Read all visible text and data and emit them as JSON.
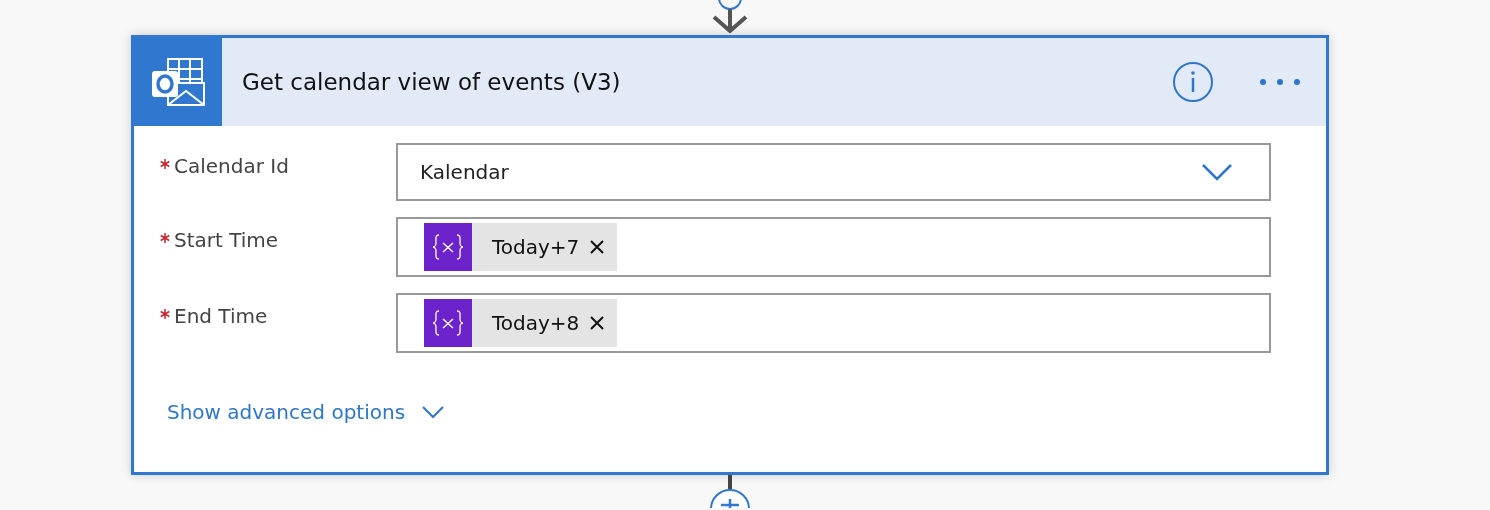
{
  "card": {
    "title": "Get calendar view of events (V3)",
    "fields": [
      {
        "label": "Calendar Id",
        "required": true,
        "kind": "dropdown",
        "value": "Kalendar"
      },
      {
        "label": "Start Time",
        "required": true,
        "kind": "tokens",
        "tokens": [
          {
            "kind": "expression",
            "label": "Today+7"
          }
        ]
      },
      {
        "label": "End Time",
        "required": true,
        "kind": "tokens",
        "tokens": [
          {
            "kind": "expression",
            "label": "Today+8"
          }
        ]
      }
    ],
    "advanced_link": "Show advanced options"
  }
}
